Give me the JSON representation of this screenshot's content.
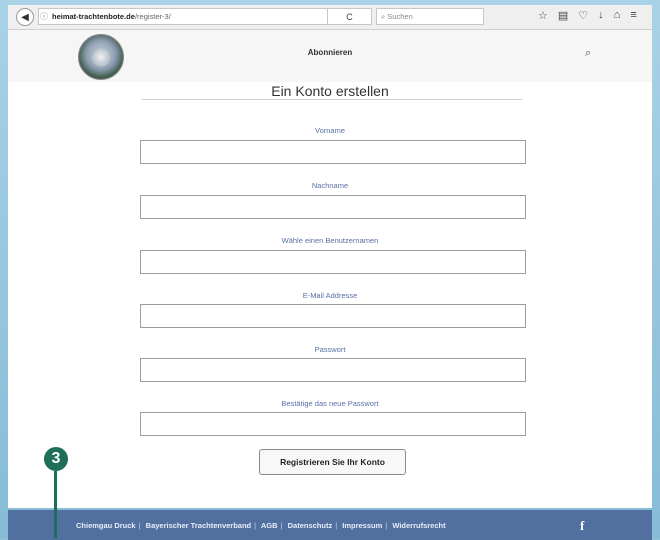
{
  "browser": {
    "url_host": "heimat-trachtenbote.de",
    "url_path": "/register-3/",
    "search_placeholder": "Suchen"
  },
  "header": {
    "nav_label": "Abonnieren"
  },
  "form": {
    "title": "Ein Konto erstellen",
    "fields": [
      {
        "label": "Vorname"
      },
      {
        "label": "Nachname"
      },
      {
        "label": "Wähle einen Benutzernamen"
      },
      {
        "label": "E-Mail Addresse"
      },
      {
        "label": "Passwort"
      },
      {
        "label": "Bestätige das neue Passwort"
      }
    ],
    "submit_label": "Registrieren Sie Ihr Konto"
  },
  "footer": {
    "links": [
      "Chiemgau Druck",
      "Bayerischer Trachtenverband",
      "AGB",
      "Datenschutz",
      "Impressum",
      "Widerrufsrecht"
    ],
    "social_icon": "facebook-icon"
  },
  "callout": {
    "number": "3",
    "color": "#1f6e59"
  }
}
